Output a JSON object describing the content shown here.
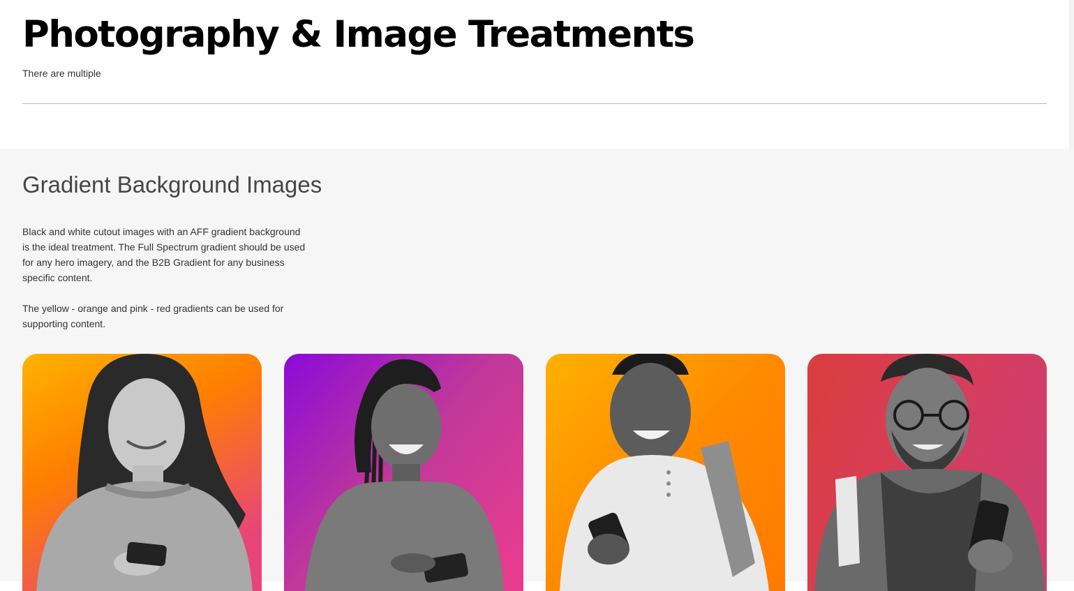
{
  "header": {
    "title": "Photography & Image Treatments",
    "subtitle": "There are multiple"
  },
  "section": {
    "title": "Gradient Background Images",
    "paragraphs": [
      "Black and white cutout images with an AFF gradient background is the ideal treatment. The Full Spectrum gradient should be used for any hero imagery, and the B2B Gradient for any business specific content.",
      "The yellow - orange and pink - red gradients can be used for supporting content."
    ]
  },
  "cards": [
    {
      "name": "woman-long-hair-phone",
      "gradient": [
        "#ffb300",
        "#ff7f00",
        "#e8447a"
      ]
    },
    {
      "name": "woman-braids-phone",
      "gradient": [
        "#8a0bd8",
        "#c0389a",
        "#e83d8f"
      ]
    },
    {
      "name": "man-backpack-phone",
      "gradient": [
        "#ffb100",
        "#ff8a00",
        "#ff7a00"
      ]
    },
    {
      "name": "man-glasses-scarf-phone",
      "gradient": [
        "#d93d3d",
        "#d83d58",
        "#cf3d6e"
      ]
    }
  ]
}
